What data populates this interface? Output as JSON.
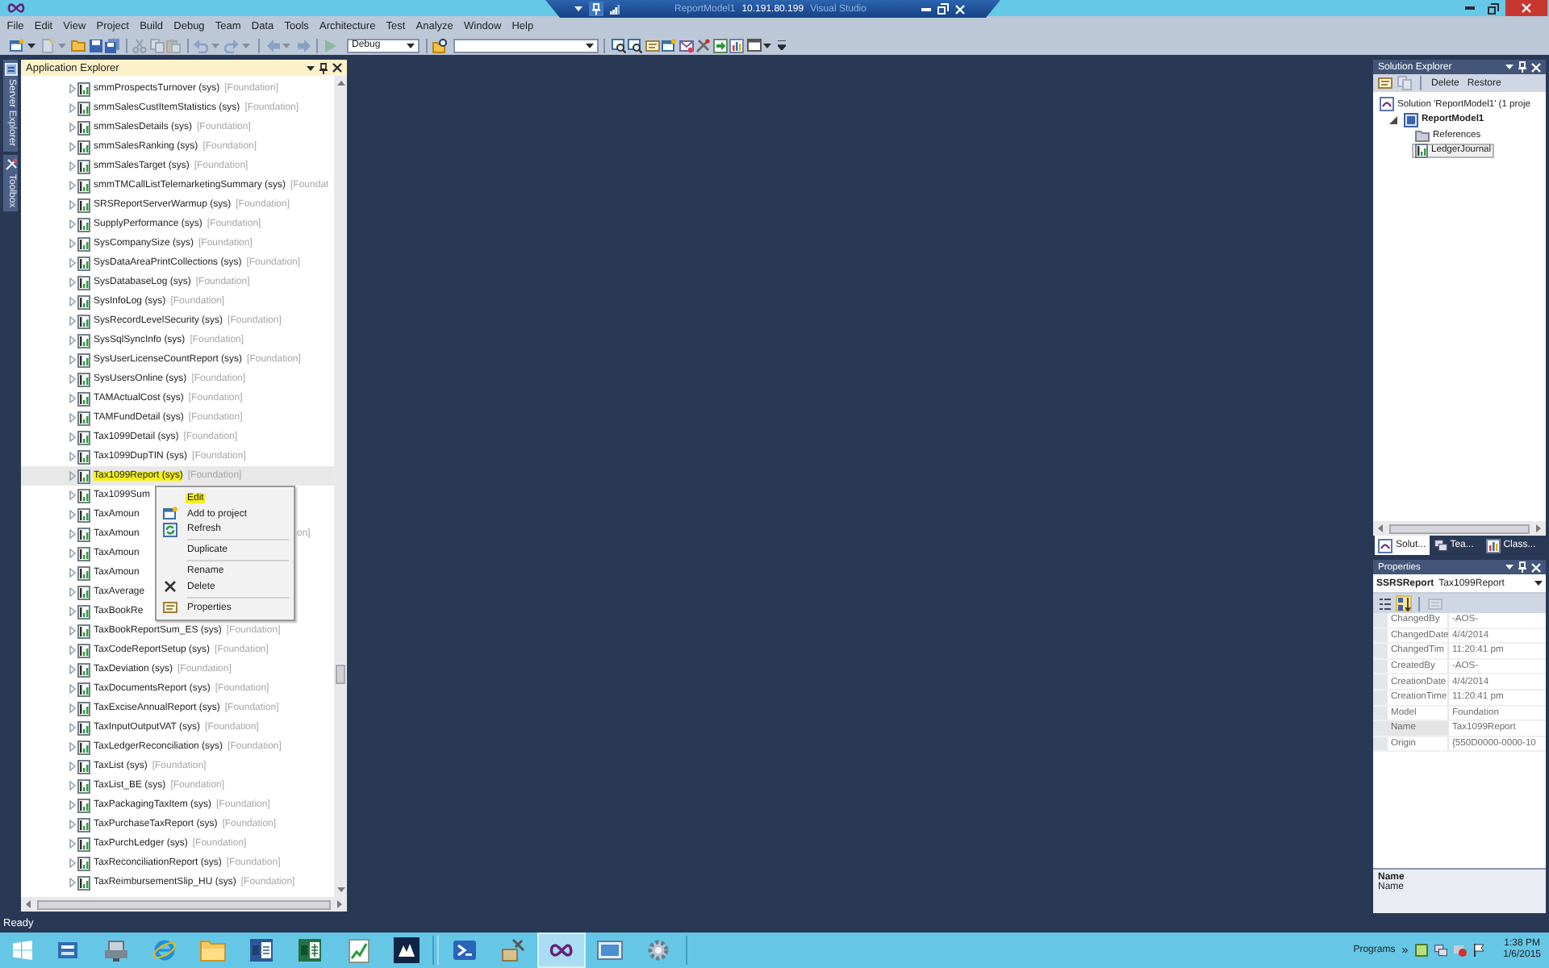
{
  "title_bar": {
    "title_start": "ReportModel1",
    "connection": "10.191.80.199",
    "title_end": "Visual Studio"
  },
  "menu": [
    "File",
    "Edit",
    "View",
    "Project",
    "Build",
    "Debug",
    "Team",
    "Data",
    "Tools",
    "Architecture",
    "Test",
    "Analyze",
    "Window",
    "Help"
  ],
  "toolbar": {
    "left_buttons": [
      {
        "disabled": false
      },
      {
        "disabled": true
      },
      {
        "disabled": false
      },
      {
        "disabled": false
      },
      {
        "disabled": false
      },
      {
        "disabled": true
      },
      {
        "disabled": true
      },
      {
        "disabled": true
      },
      {
        "disabled": true
      },
      {
        "disabled": true
      },
      {
        "disabled": true
      },
      {
        "disabled": true
      },
      {
        "disabled": true
      }
    ],
    "configuration": "Debug",
    "right_buttons": [
      {
        "disabled": false
      },
      {
        "disabled": false
      },
      {
        "disabled": false
      },
      {
        "disabled": false
      },
      {
        "disabled": false
      },
      {
        "disabled": false
      },
      {
        "disabled": false
      },
      {
        "disabled": false
      },
      {
        "disabled": false
      },
      {
        "disabled": false
      }
    ]
  },
  "side_tabs": [
    {
      "label": "Server Explorer"
    },
    {
      "label": "Toolbox"
    }
  ],
  "app_explorer": {
    "title": "Application Explorer",
    "rows": [
      {
        "name": "smmProspectsTurnover (sys)",
        "layer": "[Foundation]",
        "selected": false,
        "highlighted": false
      },
      {
        "name": "smmSalesCustItemStatistics (sys)",
        "layer": "[Foundation]",
        "selected": false,
        "highlighted": false
      },
      {
        "name": "smmSalesDetails (sys)",
        "layer": "[Foundation]",
        "selected": false,
        "highlighted": false
      },
      {
        "name": "smmSalesRanking (sys)",
        "layer": "[Foundation]",
        "selected": false,
        "highlighted": false
      },
      {
        "name": "smmSalesTarget (sys)",
        "layer": "[Foundation]",
        "selected": false,
        "highlighted": false
      },
      {
        "name": "smmTMCallListTelemarketingSummary (sys)",
        "layer": "[Foundat",
        "selected": false,
        "highlighted": false
      },
      {
        "name": "SRSReportServerWarmup (sys)",
        "layer": "[Foundation]",
        "selected": false,
        "highlighted": false
      },
      {
        "name": "SupplyPerformance (sys)",
        "layer": "[Foundation]",
        "selected": false,
        "highlighted": false
      },
      {
        "name": "SysCompanySize (sys)",
        "layer": "[Foundation]",
        "selected": false,
        "highlighted": false
      },
      {
        "name": "SysDataAreaPrintCollections (sys)",
        "layer": "[Foundation]",
        "selected": false,
        "highlighted": false
      },
      {
        "name": "SysDatabaseLog (sys)",
        "layer": "[Foundation]",
        "selected": false,
        "highlighted": false
      },
      {
        "name": "SysInfoLog (sys)",
        "layer": "[Foundation]",
        "selected": false,
        "highlighted": false
      },
      {
        "name": "SysRecordLevelSecurity (sys)",
        "layer": "[Foundation]",
        "selected": false,
        "highlighted": false
      },
      {
        "name": "SysSqlSyncInfo (sys)",
        "layer": "[Foundation]",
        "selected": false,
        "highlighted": false
      },
      {
        "name": "SysUserLicenseCountReport (sys)",
        "layer": "[Foundation]",
        "selected": false,
        "highlighted": false
      },
      {
        "name": "SysUsersOnline (sys)",
        "layer": "[Foundation]",
        "selected": false,
        "highlighted": false
      },
      {
        "name": "TAMActualCost (sys)",
        "layer": "[Foundation]",
        "selected": false,
        "highlighted": false
      },
      {
        "name": "TAMFundDetail (sys)",
        "layer": "[Foundation]",
        "selected": false,
        "highlighted": false
      },
      {
        "name": "Tax1099Detail (sys)",
        "layer": "[Foundation]",
        "selected": false,
        "highlighted": false
      },
      {
        "name": "Tax1099DupTIN (sys)",
        "layer": "[Foundation]",
        "selected": false,
        "highlighted": false
      },
      {
        "name": "Tax1099Report (sys)",
        "layer": "[Foundation]",
        "selected": true,
        "highlighted": true
      },
      {
        "name": "Tax1099Sum",
        "selected": false,
        "highlighted": false
      },
      {
        "name": "TaxAmoun",
        "selected": false,
        "highlighted": false
      },
      {
        "name": "TaxAmoun",
        "tail": "on]",
        "selected": false,
        "highlighted": false
      },
      {
        "name": "TaxAmoun",
        "selected": false,
        "highlighted": false
      },
      {
        "name": "TaxAmoun",
        "selected": false,
        "highlighted": false
      },
      {
        "name": "TaxAverage",
        "selected": false,
        "highlighted": false
      },
      {
        "name": "TaxBookRe",
        "selected": false,
        "highlighted": false
      },
      {
        "name": "TaxBookReportSum_ES (sys)",
        "layer": "[Foundation]",
        "selected": false,
        "highlighted": false
      },
      {
        "name": "TaxCodeReportSetup (sys)",
        "layer": "[Foundation]",
        "selected": false,
        "highlighted": false
      },
      {
        "name": "TaxDeviation (sys)",
        "layer": "[Foundation]",
        "selected": false,
        "highlighted": false
      },
      {
        "name": "TaxDocumentsReport (sys)",
        "layer": "[Foundation]",
        "selected": false,
        "highlighted": false
      },
      {
        "name": "TaxExciseAnnualReport (sys)",
        "layer": "[Foundation]",
        "selected": false,
        "highlighted": false
      },
      {
        "name": "TaxInputOutputVAT (sys)",
        "layer": "[Foundation]",
        "selected": false,
        "highlighted": false
      },
      {
        "name": "TaxLedgerReconciliation (sys)",
        "layer": "[Foundation]",
        "selected": false,
        "highlighted": false
      },
      {
        "name": "TaxList (sys)",
        "layer": "[Foundation]",
        "selected": false,
        "highlighted": false
      },
      {
        "name": "TaxList_BE (sys)",
        "layer": "[Foundation]",
        "selected": false,
        "highlighted": false
      },
      {
        "name": "TaxPackagingTaxItem (sys)",
        "layer": "[Foundation]",
        "selected": false,
        "highlighted": false
      },
      {
        "name": "TaxPurchaseTaxReport (sys)",
        "layer": "[Foundation]",
        "selected": false,
        "highlighted": false
      },
      {
        "name": "TaxPurchLedger (sys)",
        "layer": "[Foundation]",
        "selected": false,
        "highlighted": false
      },
      {
        "name": "TaxReconciliationReport (sys)",
        "layer": "[Foundation]",
        "selected": false,
        "highlighted": false
      },
      {
        "name": "TaxReimbursementSlip_HU (sys)",
        "layer": "[Foundation]",
        "selected": false,
        "highlighted": false
      }
    ]
  },
  "context_menu": {
    "items": [
      {
        "kind": "item",
        "label": "Edit",
        "highlighted": true
      },
      {
        "kind": "item",
        "label": "Add to project",
        "highlighted": false
      },
      {
        "kind": "item",
        "label": "Refresh",
        "highlighted": false
      },
      {
        "kind": "separator"
      },
      {
        "kind": "item",
        "label": "Duplicate",
        "highlighted": false
      },
      {
        "kind": "separator"
      },
      {
        "kind": "item",
        "label": "Rename",
        "highlighted": false
      },
      {
        "kind": "item",
        "label": "Delete",
        "highlighted": false
      },
      {
        "kind": "separator"
      },
      {
        "kind": "item",
        "label": "Properties",
        "highlighted": false
      }
    ]
  },
  "solution_explorer": {
    "title": "Solution Explorer",
    "icon_buttons": [
      {
        "disabled": false
      },
      {
        "disabled": true
      }
    ],
    "buttons": [
      "Delete",
      "Restore"
    ],
    "tree": [
      {
        "label": "Solution 'ReportModel1' (1 proje",
        "kind": "solution",
        "selected": false,
        "children": [
          {
            "label": "ReportModel1",
            "kind": "project",
            "expanded": true,
            "selected": false,
            "children": [
              {
                "label": "References",
                "kind": "folder",
                "selected": false
              },
              {
                "label": "LedgerJournal",
                "kind": "report",
                "selected": true
              }
            ]
          }
        ]
      }
    ],
    "tabs": [
      {
        "label": "Solut...",
        "selected": true
      },
      {
        "label": "Tea...",
        "selected": false
      },
      {
        "label": "Class...",
        "selected": false
      }
    ]
  },
  "properties": {
    "title": "Properties",
    "object_type": "SSRSReport",
    "object_name": "Tax1099Report",
    "toolbar": [
      {
        "kind": "categorized",
        "selected": false,
        "disabled": false
      },
      {
        "kind": "alphabetical",
        "selected": true,
        "disabled": false
      },
      {
        "kind": "pages",
        "selected": false,
        "disabled": true
      }
    ],
    "rows": [
      {
        "name": "ChangedBy",
        "value": "-AOS-",
        "selected": false
      },
      {
        "name": "ChangedDate",
        "value": "4/4/2014",
        "selected": false
      },
      {
        "name": "ChangedTim",
        "value": "11:20:41 pm",
        "selected": false
      },
      {
        "name": "CreatedBy",
        "value": "-AOS-",
        "selected": false
      },
      {
        "name": "CreationDate",
        "value": "4/4/2014",
        "selected": false
      },
      {
        "name": "CreationTime",
        "value": "11:20:41 pm",
        "selected": false
      },
      {
        "name": "Model",
        "value": "Foundation",
        "selected": false
      },
      {
        "name": "Name",
        "value": "Tax1099Report",
        "selected": true
      },
      {
        "name": "Origin",
        "value": "{550D0000-0000-10",
        "selected": false
      }
    ],
    "description": {
      "title": "Name",
      "text": "Name"
    }
  },
  "status_bar": {
    "text": "Ready"
  },
  "taskbar": {
    "apps": [
      {
        "selected": false
      },
      {
        "selected": false
      },
      {
        "selected": false
      },
      {
        "selected": false
      },
      {
        "selected": false
      },
      {
        "selected": false
      },
      {
        "selected": false
      },
      {
        "selected": false
      },
      {
        "selected": false
      },
      {
        "selected": false
      },
      {
        "selected": true
      },
      {
        "selected": false
      },
      {
        "selected": false
      }
    ],
    "toolbar_label": "Programs",
    "chevron": "»",
    "clock": {
      "time": "1:38 PM",
      "date": "1/6/2015"
    }
  }
}
